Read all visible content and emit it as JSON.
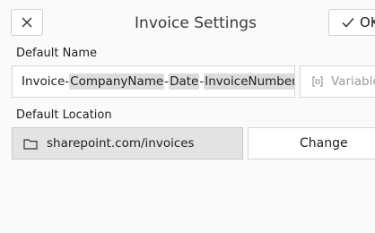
{
  "dialog": {
    "title": "Invoice Settings",
    "close_icon": "close-icon",
    "ok_icon": "checkmark-icon",
    "ok_label": "OK"
  },
  "name_section": {
    "label": "Default Name",
    "value_parts": [
      {
        "text": "Invoice-",
        "token": false
      },
      {
        "text": "CompanyName",
        "token": true
      },
      {
        "text": "-",
        "token": false
      },
      {
        "text": "Date",
        "token": true
      },
      {
        "text": "-",
        "token": false
      },
      {
        "text": "InvoiceNumber",
        "token": true
      }
    ],
    "variables_icon": "variable-icon",
    "variables_label": "Variables"
  },
  "location_section": {
    "label": "Default Location",
    "folder_icon": "folder-icon",
    "path": "sharepoint.com/invoices",
    "change_label": "Change"
  },
  "colors": {
    "token_bg": "#dcdcdc",
    "location_bg": "#e3e3e3",
    "disabled_text": "#9a9a9a"
  }
}
